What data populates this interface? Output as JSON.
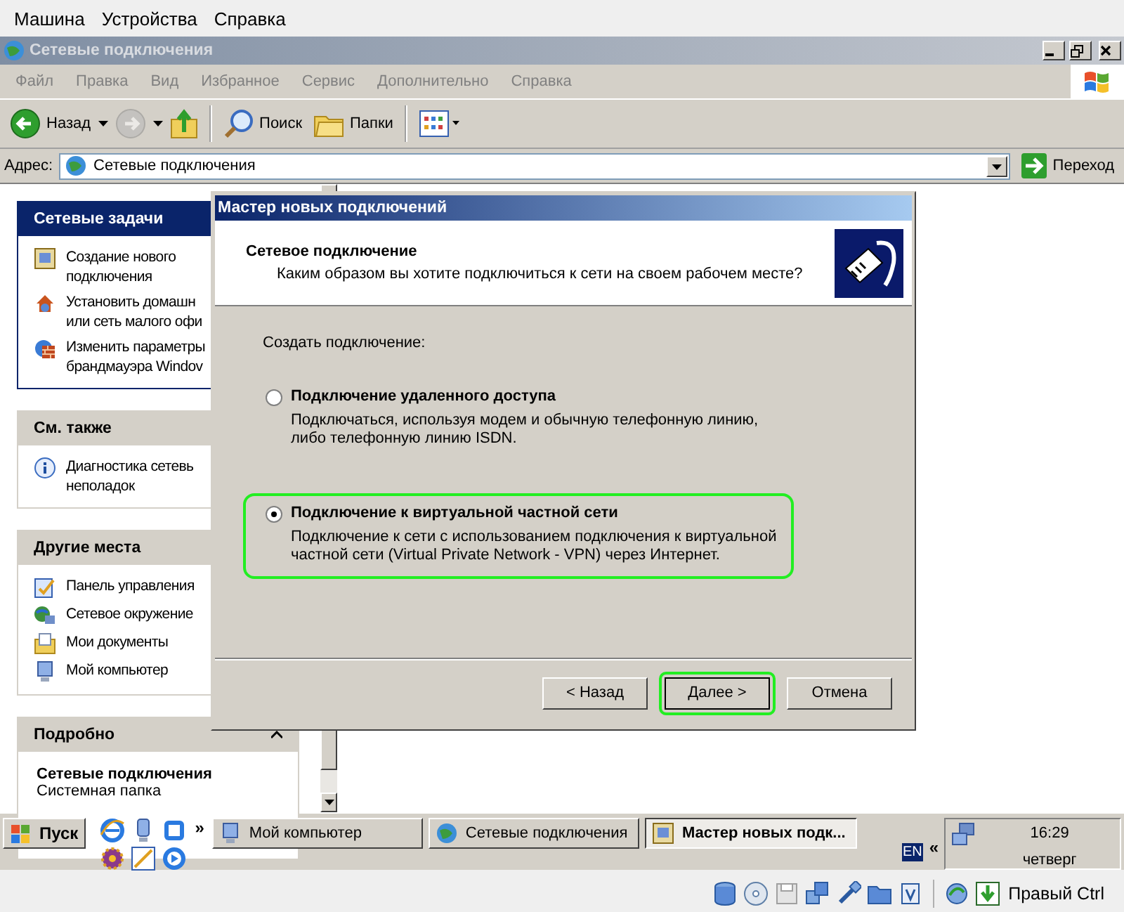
{
  "vm_menu": [
    "Машина",
    "Устройства",
    "Справка"
  ],
  "window": {
    "title": "Сетевые подключения",
    "menu": [
      {
        "label": "Файл",
        "disabled": true
      },
      {
        "label": "Правка",
        "disabled": true
      },
      {
        "label": "Вид",
        "disabled": true
      },
      {
        "label": "Избранное",
        "disabled": true
      },
      {
        "label": "Сервис",
        "disabled": true
      },
      {
        "label": "Дополнительно",
        "disabled": true
      },
      {
        "label": "Справка",
        "disabled": true
      }
    ],
    "toolbar": [
      {
        "kind": "back",
        "label": "Назад",
        "disabled": false
      },
      {
        "kind": "forward",
        "disabled": true
      },
      {
        "kind": "up",
        "disabled": false
      },
      {
        "kind": "search",
        "label": "Поиск",
        "disabled": false
      },
      {
        "kind": "folders",
        "label": "Папки",
        "disabled": false
      },
      {
        "kind": "views",
        "disabled": false
      }
    ],
    "address": {
      "label": "Адрес:",
      "value": "Сетевые подключения",
      "go": "Переход"
    }
  },
  "sidebar": {
    "panels": [
      {
        "kind": "primary",
        "title": "Сетевые задачи",
        "items": [
          {
            "kind": "wizard",
            "lines": [
              "Создание нового",
              "подключения"
            ]
          },
          {
            "kind": "home-network",
            "lines": [
              "Установить домашн",
              "или сеть малого офи"
            ]
          },
          {
            "kind": "firewall",
            "lines": [
              "Изменить параметры",
              "брандмауэра Windov"
            ]
          }
        ]
      },
      {
        "kind": "normal",
        "title": "См. также",
        "items": [
          {
            "kind": "diagnostics",
            "lines": [
              "Диагностика сетевь",
              "неполадок"
            ]
          }
        ]
      },
      {
        "kind": "normal",
        "title": "Другие места",
        "items": [
          {
            "kind": "control-panel",
            "lines": [
              "Панель управления"
            ]
          },
          {
            "kind": "network-places",
            "lines": [
              "Сетевое окружение"
            ]
          },
          {
            "kind": "documents",
            "lines": [
              "Мои документы"
            ]
          },
          {
            "kind": "computer",
            "lines": [
              "Мой компьютер"
            ]
          }
        ]
      },
      {
        "kind": "details",
        "title": "Подробно",
        "name": "Сетевые подключения",
        "type": "Системная папка"
      }
    ]
  },
  "dialog": {
    "title": "Мастер новых подключений",
    "heading": "Сетевое подключение",
    "subheading": "Каким образом вы хотите подключиться к сети на своем рабочем месте?",
    "prompt": "Создать подключение:",
    "options": [
      {
        "title": "Подключение удаленного доступа",
        "description": "Подключаться, используя модем и обычную телефонную линию, либо телефонную линию ISDN.",
        "selected": false,
        "highlighted": false
      },
      {
        "title": "Подключение к виртуальной частной сети",
        "description": "Подключение к сети с использованием подключения к виртуальной частной сети (Virtual Private Network - VPN) через Интернет.",
        "selected": true,
        "highlighted": true
      }
    ],
    "buttons": [
      {
        "label": "< Назад",
        "highlighted": false
      },
      {
        "label": "Далее >",
        "highlighted": true
      },
      {
        "label": "Отмена",
        "highlighted": false
      }
    ]
  },
  "taskbar": {
    "start": "Пуск",
    "more": "»",
    "tasks": [
      {
        "kind": "computer",
        "label": "Мой компьютер",
        "selected": false
      },
      {
        "kind": "network",
        "label": "Сетевые подключения",
        "selected": false
      },
      {
        "kind": "wizard",
        "label": "Мастер новых подк...",
        "selected": true
      }
    ],
    "language": "EN",
    "tray_toggle": "«",
    "time": "16:29",
    "day": "четверг"
  },
  "status_bar": {
    "host_key": "Правый Ctrl"
  }
}
